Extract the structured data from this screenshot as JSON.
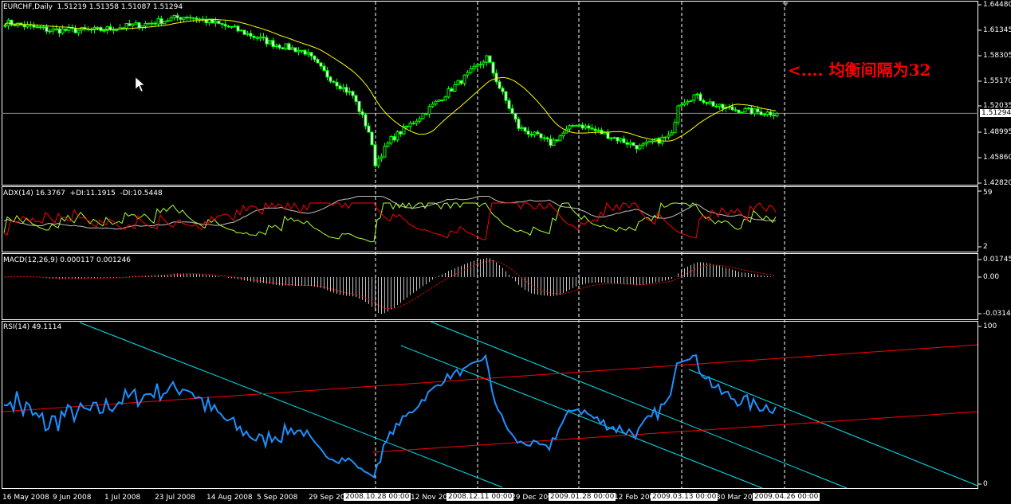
{
  "main": {
    "symbol_label": "EURCHF,Daily  1.51219 1.51358 1.51087 1.51294",
    "price_axis": [
      "1.64480",
      "1.61345",
      "1.58305",
      "1.55170",
      "1.52035",
      "1.48995",
      "1.45860",
      "1.42820"
    ],
    "current_price": "1.51294",
    "annotation": "<.... 均衡间隔为32"
  },
  "adx": {
    "label": "ADX(14) 16.3767  +DI:11.1915  -DI:10.5448",
    "axis": [
      "59",
      "2"
    ]
  },
  "macd": {
    "label": "MACD(12,26,9) 0.000117 0.001246",
    "axis": [
      "0.017458",
      "0.00",
      "-0.03149"
    ]
  },
  "rsi": {
    "label": "RSI(14) 49.1114",
    "axis": [
      "100",
      "0"
    ]
  },
  "time_axis": {
    "labels": [
      "16 May 2008",
      "9 Jun 2008",
      "1 Jul 2008",
      "23 Jul 2008",
      "14 Aug 2008",
      "5 Sep 2008",
      "29 Sep 200",
      "12 Nov 200",
      "29 Dec 200",
      "12 Feb 200",
      "30 Mar 200"
    ],
    "highlighted": [
      "2008.10.28 00:00",
      "2008.12.11 00:00",
      "2009.01.28 00:00",
      "2009.03.13 00:00",
      "2009.04.26 00:00"
    ]
  },
  "colors": {
    "candle": "#00ff00",
    "ma": "#ffff00",
    "plus_di": "#adff2f",
    "minus_di": "#ff0000",
    "adx": "#c0c0c0",
    "rsi": "#1e90ff",
    "trend_cyan": "#00e5ee",
    "trend_red": "#ff0000",
    "annotation": "#ff0000"
  },
  "chart_data": {
    "type": "candlestick",
    "symbol": "EURCHF",
    "timeframe": "Daily",
    "ylim": [
      1.4282,
      1.6448
    ],
    "close_keypoints": [
      {
        "bar": 0,
        "close": 1.6235
      },
      {
        "bar": 14,
        "close": 1.6139
      },
      {
        "bar": 29,
        "close": 1.6139
      },
      {
        "bar": 44,
        "close": 1.6216
      },
      {
        "bar": 57,
        "close": 1.6313
      },
      {
        "bar": 71,
        "close": 1.6168
      },
      {
        "bar": 84,
        "close": 1.5974
      },
      {
        "bar": 94,
        "close": 1.5877
      },
      {
        "bar": 101,
        "close": 1.5587
      },
      {
        "bar": 109,
        "close": 1.5346
      },
      {
        "bar": 114,
        "close": 1.491
      },
      {
        "bar": 116,
        "close": 1.4524
      },
      {
        "bar": 121,
        "close": 1.4814
      },
      {
        "bar": 129,
        "close": 1.5056
      },
      {
        "bar": 139,
        "close": 1.5394
      },
      {
        "bar": 149,
        "close": 1.5732
      },
      {
        "bar": 151,
        "close": 1.581
      },
      {
        "bar": 155,
        "close": 1.5442
      },
      {
        "bar": 161,
        "close": 1.4959
      },
      {
        "bar": 171,
        "close": 1.4765
      },
      {
        "bar": 179,
        "close": 1.5007
      },
      {
        "bar": 189,
        "close": 1.4862
      },
      {
        "bar": 199,
        "close": 1.4717
      },
      {
        "bar": 209,
        "close": 1.4862
      },
      {
        "bar": 211,
        "close": 1.5249
      },
      {
        "bar": 216,
        "close": 1.5346
      },
      {
        "bar": 224,
        "close": 1.5201
      },
      {
        "bar": 234,
        "close": 1.5152
      },
      {
        "bar": 242,
        "close": 1.5129
      }
    ],
    "macd_range": [
      -0.03149,
      0.017458
    ],
    "adx_range": [
      2,
      59
    ],
    "rsi_range": [
      0,
      100
    ]
  }
}
